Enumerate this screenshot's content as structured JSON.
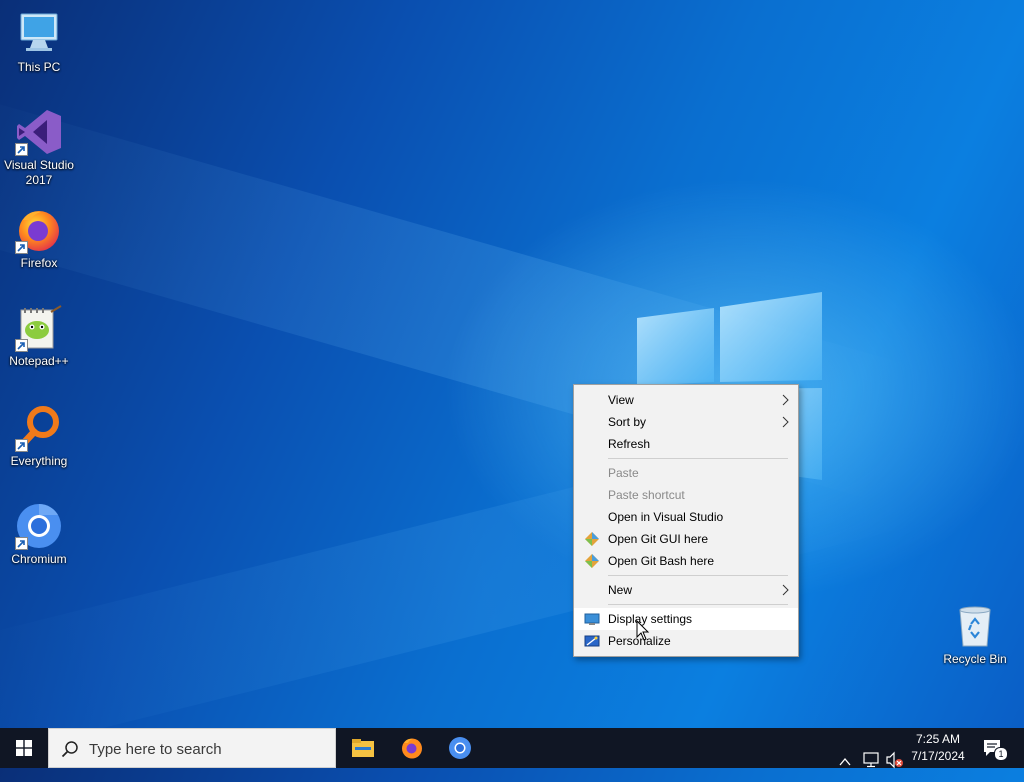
{
  "desktop_icons": [
    {
      "id": "this-pc",
      "label": "This PC"
    },
    {
      "id": "visual-studio",
      "label": "Visual Studio 2017"
    },
    {
      "id": "firefox",
      "label": "Firefox"
    },
    {
      "id": "notepadpp",
      "label": "Notepad++"
    },
    {
      "id": "everything",
      "label": "Everything"
    },
    {
      "id": "chromium",
      "label": "Chromium"
    },
    {
      "id": "recycle-bin",
      "label": "Recycle Bin"
    }
  ],
  "context_menu": {
    "items": [
      {
        "label": "View",
        "submenu": true,
        "enabled": true
      },
      {
        "label": "Sort by",
        "submenu": true,
        "enabled": true
      },
      {
        "label": "Refresh",
        "enabled": true
      },
      {
        "label": "Paste",
        "enabled": false
      },
      {
        "label": "Paste shortcut",
        "enabled": false
      },
      {
        "label": "Open in Visual Studio",
        "enabled": true
      },
      {
        "label": "Open Git GUI here",
        "enabled": true,
        "icon": "git-icon"
      },
      {
        "label": "Open Git Bash here",
        "enabled": true,
        "icon": "git-icon"
      },
      {
        "label": "New",
        "submenu": true,
        "enabled": true
      },
      {
        "label": "Display settings",
        "enabled": true,
        "icon": "display-icon",
        "hovered": true
      },
      {
        "label": "Personalize",
        "enabled": true,
        "icon": "personalize-icon"
      }
    ]
  },
  "taskbar": {
    "search_placeholder": "Type here to search",
    "apps": [
      "file-explorer-icon",
      "firefox-icon",
      "chromium-icon"
    ],
    "clock": {
      "time": "7:25 AM",
      "date": "7/17/2024"
    },
    "notification_count": "1"
  },
  "colors": {
    "taskbar": "#101624",
    "menu_background": "#f2f2f2",
    "desktop_blue": "#0a6fd0"
  }
}
